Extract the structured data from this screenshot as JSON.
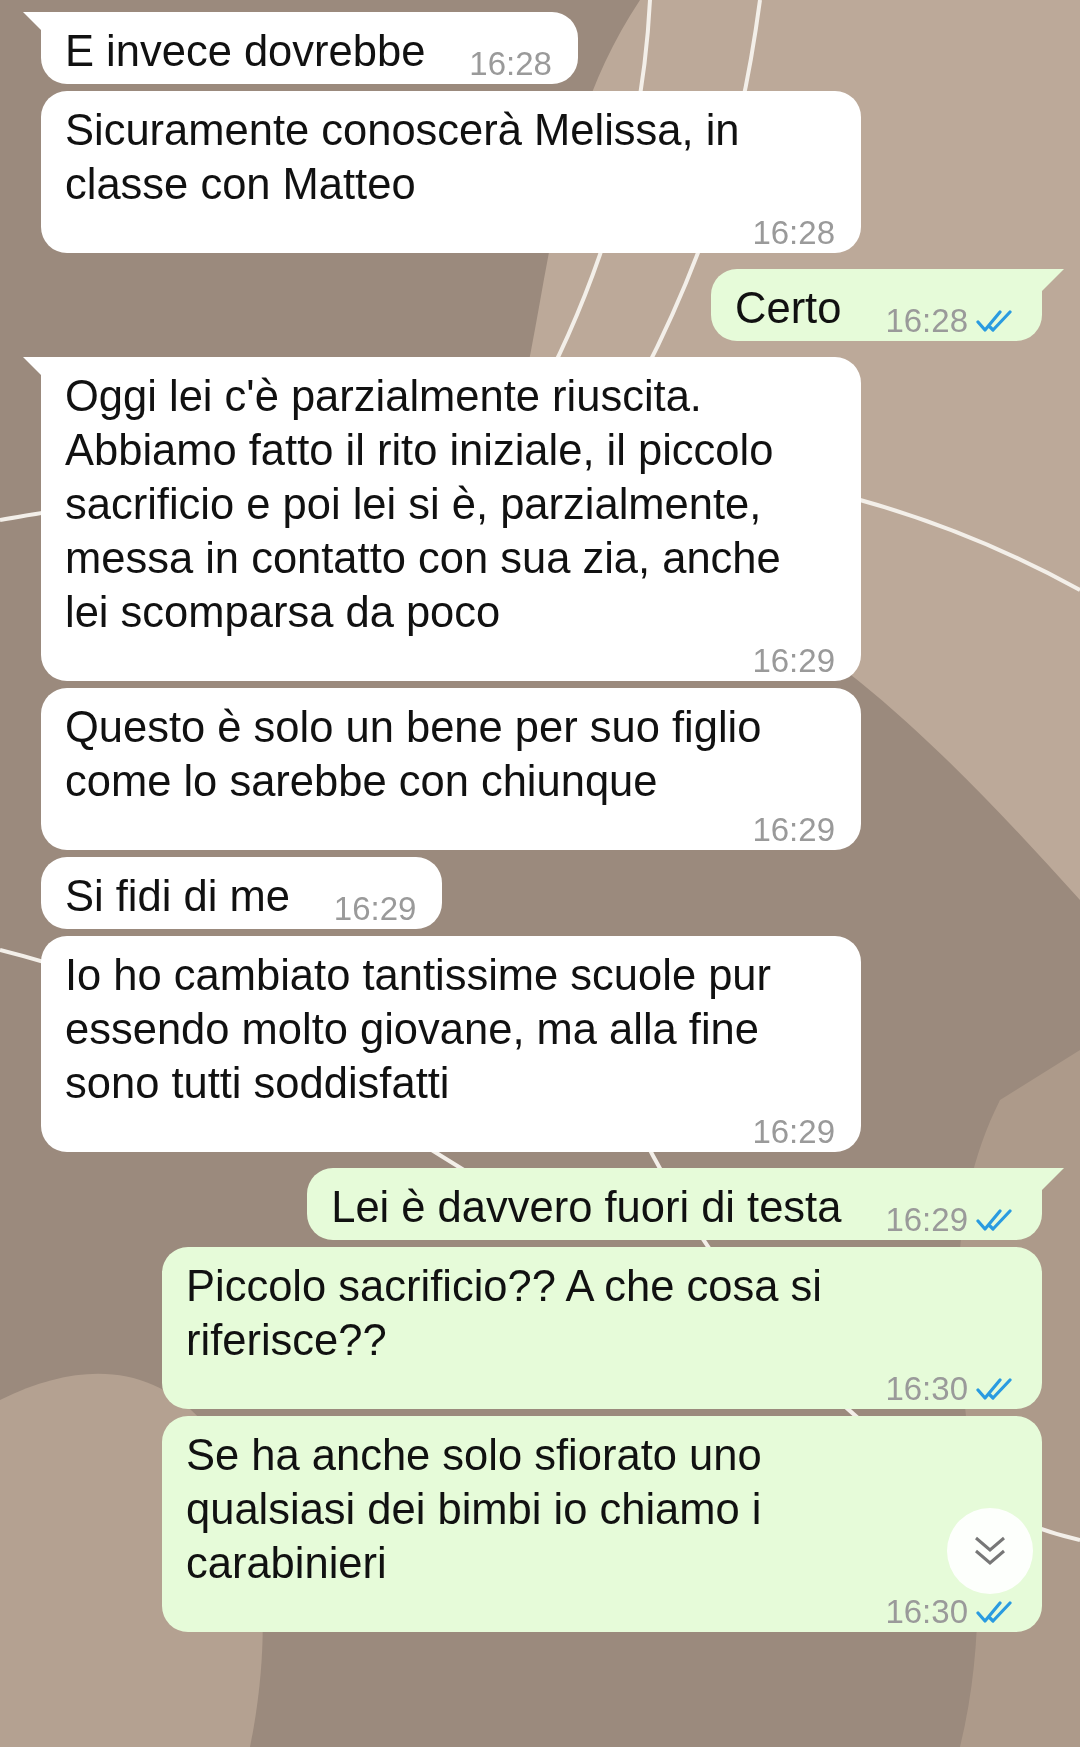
{
  "messages": [
    {
      "kind": "incoming",
      "tail": true,
      "text": "E invece dovrebbe",
      "time": "16:28"
    },
    {
      "kind": "incoming",
      "tail": false,
      "text": "Sicuramente conoscerà Melissa, in classe con Matteo",
      "time": "16:28"
    },
    {
      "kind": "outgoing",
      "tail": true,
      "text": "Certo",
      "time": "16:28",
      "read": true
    },
    {
      "kind": "incoming",
      "tail": true,
      "text": "Oggi lei c'è parzialmente riuscita. Abbiamo fatto il rito iniziale, il piccolo sacrificio e poi lei si è, parzialmente, messa in contatto con sua zia, anche lei scomparsa da poco",
      "time": "16:29"
    },
    {
      "kind": "incoming",
      "tail": false,
      "text": "Questo è solo un bene per suo figlio come lo sarebbe con chiunque",
      "time": "16:29"
    },
    {
      "kind": "incoming",
      "tail": false,
      "text": "Si fidi di me",
      "time": "16:29"
    },
    {
      "kind": "incoming",
      "tail": false,
      "text": "Io ho cambiato tantissime scuole pur essendo molto giovane, ma alla fine sono tutti soddisfatti",
      "time": "16:29"
    },
    {
      "kind": "outgoing",
      "tail": true,
      "text": "Lei è davvero fuori di testa",
      "time": "16:29",
      "read": true
    },
    {
      "kind": "outgoing",
      "tail": false,
      "text": "Piccolo sacrificio?? A che cosa si riferisce??",
      "time": "16:30",
      "read": true
    },
    {
      "kind": "outgoing",
      "tail": false,
      "text": "Se ha anche solo sfiorato uno qualsiasi dei bimbi io chiamo i carabinieri",
      "time": "16:30",
      "read": true
    }
  ]
}
